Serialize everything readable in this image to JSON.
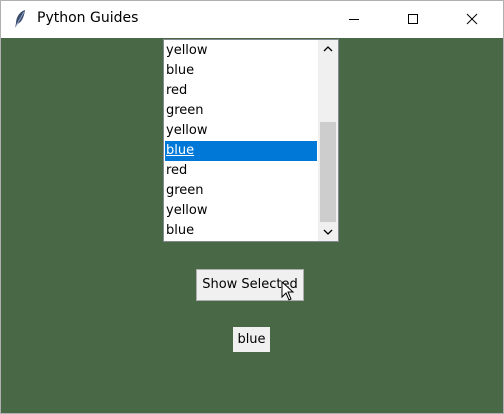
{
  "window": {
    "title": "Python Guides",
    "icon": "feather-icon",
    "background_color": "#496845"
  },
  "titlebar_buttons": [
    "minimize-icon",
    "maximize-icon",
    "close-icon"
  ],
  "listbox": {
    "items": [
      "yellow",
      "blue",
      "red",
      "green",
      "yellow",
      "blue",
      "red",
      "green",
      "yellow",
      "blue"
    ],
    "selected_index": 5,
    "selection_color": "#0078d7"
  },
  "show_button": {
    "label": "Show Selected"
  },
  "result": {
    "text": "blue"
  }
}
